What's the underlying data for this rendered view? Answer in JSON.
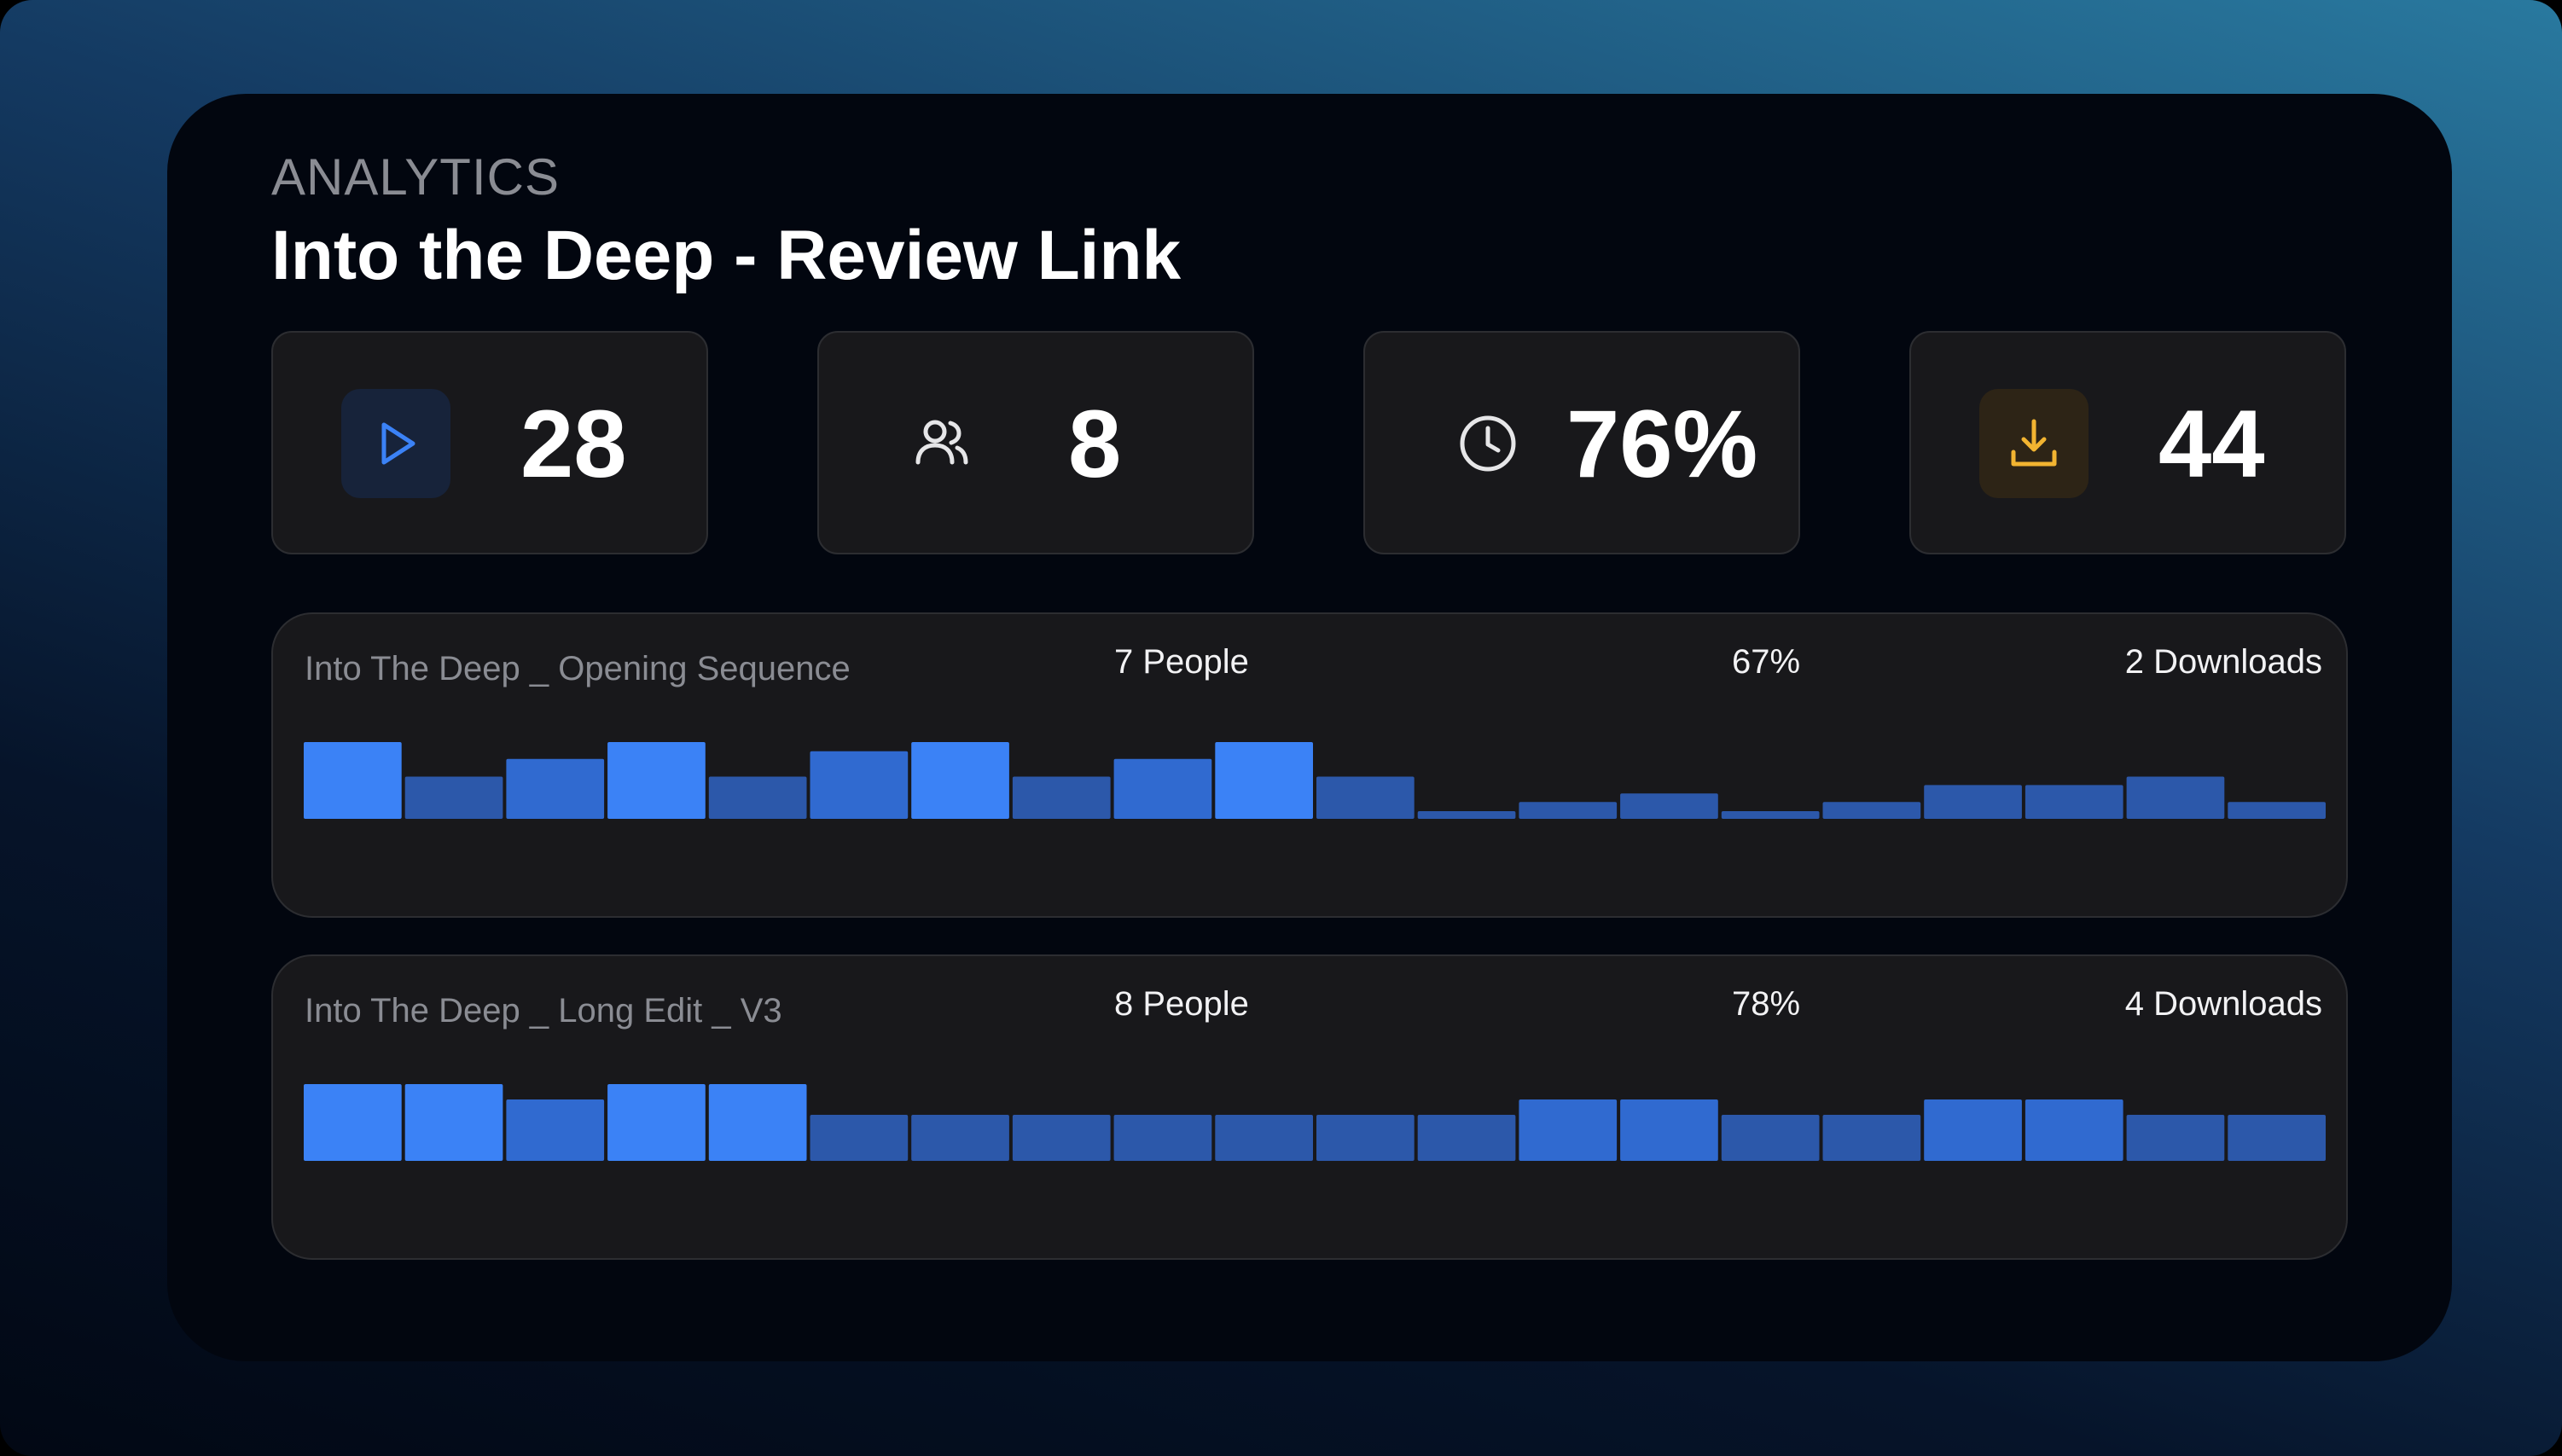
{
  "header": {
    "eyebrow": "ANALYTICS",
    "title": "Into the Deep - Review Link"
  },
  "stats": [
    {
      "icon": "play-icon",
      "value": "28",
      "icon_color": "#3b82f6",
      "icon_bg": "#17233a"
    },
    {
      "icon": "users-icon",
      "value": "8",
      "icon_color": "#e6e6e8",
      "icon_bg": "transparent"
    },
    {
      "icon": "clock-icon",
      "value": "76%",
      "icon_color": "#e6e6e8",
      "icon_bg": "transparent"
    },
    {
      "icon": "download-icon",
      "value": "44",
      "icon_color": "#f2b431",
      "icon_bg": "#2d2416"
    }
  ],
  "assets": [
    {
      "name": "Into The Deep _ Opening Sequence",
      "people": "7 People",
      "percent": "67%",
      "downloads": "2 Downloads"
    },
    {
      "name": "Into The Deep _ Long Edit _ V3",
      "people": "8 People",
      "percent": "78%",
      "downloads": "4 Downloads"
    }
  ],
  "chart_data": [
    {
      "type": "bar",
      "values": [
        100,
        55,
        78,
        100,
        55,
        88,
        100,
        55,
        78,
        100,
        55,
        10,
        22,
        33,
        10,
        22,
        44,
        44,
        55,
        22
      ]
    },
    {
      "type": "bar",
      "values": [
        100,
        100,
        80,
        100,
        100,
        60,
        60,
        60,
        60,
        60,
        60,
        60,
        80,
        80,
        60,
        60,
        80,
        80,
        60,
        60
      ]
    }
  ],
  "colors": {
    "bar_high": "#3b82f6",
    "bar_mid": "#306ad0",
    "bar_low": "#2c58aa"
  }
}
